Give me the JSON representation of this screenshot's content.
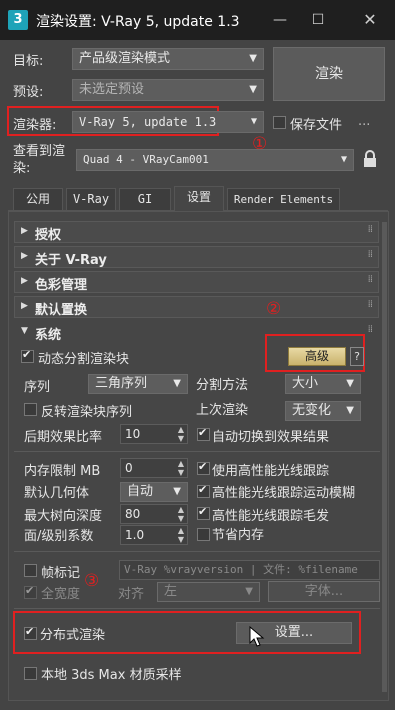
{
  "window": {
    "title": "渲染设置: V-Ray 5, update 1.3",
    "icon_text": "3"
  },
  "target": {
    "label": "目标:",
    "value": "产品级渲染模式"
  },
  "preset": {
    "label": "预设:",
    "value": "未选定预设"
  },
  "renderer": {
    "label": "渲染器:",
    "value": "V-Ray 5, update 1.3",
    "save_file": "保存文件",
    "more": "..."
  },
  "render_button": "渲染",
  "view": {
    "label": "查看到渲染:",
    "value": "Quad 4 - VRayCam001"
  },
  "annotations": {
    "one": "①",
    "two": "②",
    "three": "③"
  },
  "tabs": [
    "公用",
    "V-Ray",
    "GI",
    "设置",
    "Render Elements"
  ],
  "rollouts": [
    "授权",
    "关于 V-Ray",
    "色彩管理",
    "默认置换",
    "系统"
  ],
  "system": {
    "dynamic_split": "动态分割渲染块",
    "advanced_btn": "高级",
    "help": "?",
    "sequence_label": "序列",
    "sequence_value": "三角序列",
    "split_label": "分割方法",
    "split_value": "大小",
    "reverse": "反转渲染块序列",
    "last_label": "上次渲染",
    "last_value": "无变化",
    "post_label": "后期效果比率",
    "post_value": "10",
    "auto_switch": "自动切换到效果结果",
    "mem_label": "内存限制 MB",
    "mem_value": "0",
    "hp_raytrace": "使用高性能光线跟踪",
    "geom_label": "默认几何体",
    "geom_value": "自动",
    "hp_motion": "高性能光线跟踪运动模糊",
    "depth_label": "最大树向深度",
    "depth_value": "80",
    "hp_hair": "高性能光线跟踪毛发",
    "face_label": "面/级别系数",
    "face_value": "1.0",
    "save_mem": "节省内存",
    "frame_stamp": "帧标记",
    "stamp_text": "V-Ray %vrayversion | 文件: %filename",
    "full_width": "全宽度",
    "align_label": "对齐",
    "align_value": "左",
    "font_btn": "字体...",
    "distributed": "分布式渲染",
    "settings_btn": "设置...",
    "local_sampling": "本地 3ds Max 材质采样"
  }
}
